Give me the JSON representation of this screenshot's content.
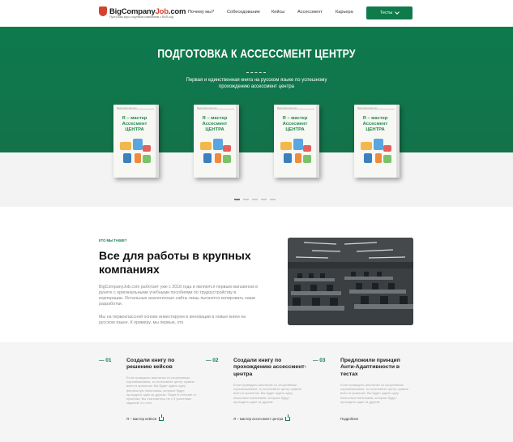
{
  "header": {
    "logo_main": "BigCompany",
    "logo_accent": "Job",
    "logo_suffix": ".com",
    "logo_tagline": "Пусть ваш курс к крупным компаниям с BAR-код",
    "nav": [
      "Почему мы?",
      "Собеседование",
      "Кейсы",
      "Ассессмент",
      "Карьера"
    ],
    "tests_button": "Тесты"
  },
  "hero": {
    "title": "ПОДГОТОВКА К АССЕССМЕНТ ЦЕНТРУ",
    "subtitle": "Первая и единственная книга на русском языке по успешному прохождению ассессмент центра",
    "book_title": "Я – мастер Ассесмент ЦЕНТРА",
    "book_brand": "BigCompanyJob.com",
    "slides": 5,
    "active_slide": 0
  },
  "about": {
    "kicker": "КТО МЫ ТАКИЕ?",
    "title": "Все для работы в крупных компаниях",
    "paragraph1": "BigCompanyJob.com работает уже с 2018 года и являются первым магазином в рунете с оригинальными учебными пособиями по трудоустройству в корпорации. Остальные аналогичные сайты лишь пытаются копировать наши разработки.",
    "paragraph2": "Мы на первоклассной основе инвестируем в инновации в новые книги на русском языке. К примеру, мы первые, кто"
  },
  "features": [
    {
      "num": "— 01",
      "title": "Создали книгу по решению кейсов",
      "text": "Если проводить аналогию со спортивным соревнованием, то ассессмент центр сравни всего в проектом. Вы будет ждать одну финальную попытками, которые будут проходить один за другим. Также в отличие от практики. Вы становитесь не с 5 участники задачей, а с того",
      "link": "Я – мастер кейсов"
    },
    {
      "num": "— 02",
      "title": "Создали книгу по прохождению ассессмент-центра",
      "text": "Если проводить аналогию со спортивным соревнованием, то ассессмент центр сравни всего в проектом. Вы будет ждать одну несколько попытками, которые будут проходить один за другим.",
      "link": "Я – мастер ассессмент центра"
    },
    {
      "num": "— 03",
      "title": "Предложили принцип Анти-Адаптивности в тестах",
      "text": "Если проводить аналогию со спортивным соревнованием, то ассессмент центр сравни всего в практике. Вы будет ждать одну несколько попытками, которые будут проходить один за другим.",
      "link": "Подробнее"
    }
  ],
  "colors": {
    "brand_green": "#0f7a4a",
    "logo_red": "#d6402e"
  }
}
